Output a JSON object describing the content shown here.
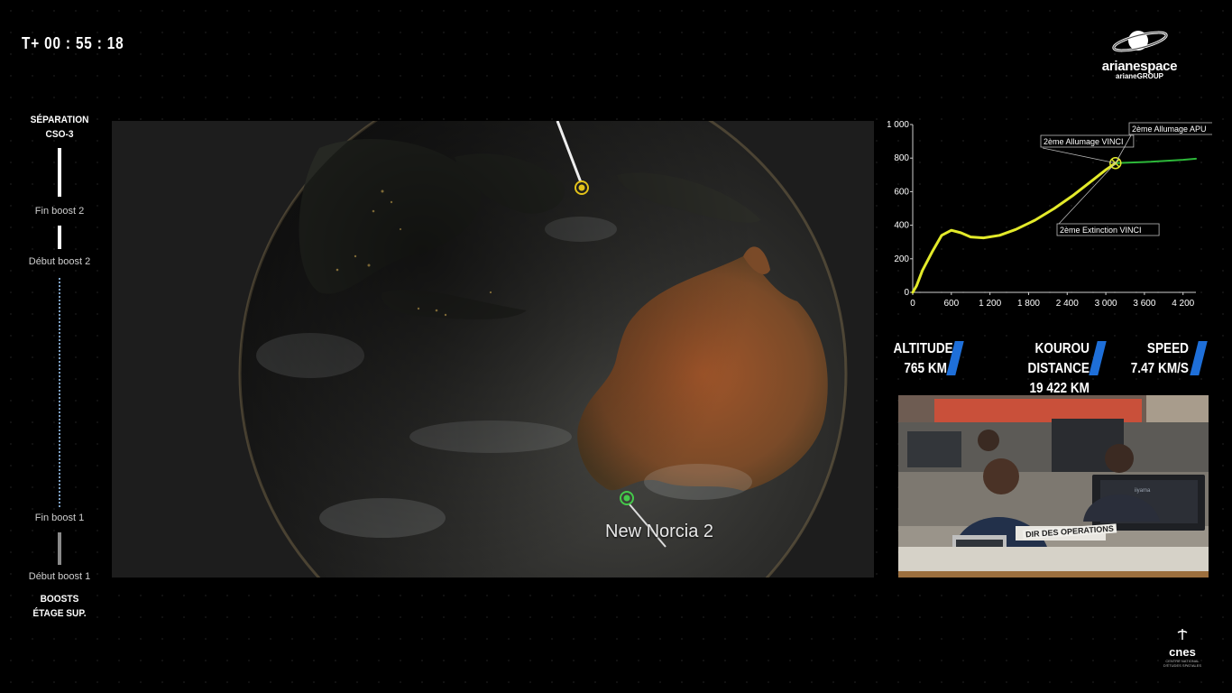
{
  "timer": "T+ 00 : 55 : 18",
  "logo": {
    "brand": "arianespace",
    "sub": "arianeGROUP"
  },
  "timeline": {
    "separation_line1": "SÉPARATION",
    "separation_line2": "CSO-3",
    "fin_boost_2": "Fin boost 2",
    "debut_boost_2": "Début boost 2",
    "fin_boost_1": "Fin boost 1",
    "debut_boost_1": "Début boost 1",
    "boosts_line1": "BOOSTS",
    "boosts_line2": "ÉTAGE SUP."
  },
  "map": {
    "station_label": "New Norcia 2"
  },
  "chart_data": {
    "type": "line",
    "x_ticks": [
      "0",
      "600",
      "1 200",
      "1 800",
      "2 400",
      "3 000",
      "3 600",
      "4 200"
    ],
    "y_ticks": [
      "0",
      "200",
      "400",
      "600",
      "800",
      "1 000"
    ],
    "xlim": [
      0,
      4400
    ],
    "ylim": [
      0,
      1000
    ],
    "series": [
      {
        "color": "#e3ea2a",
        "x": [
          0,
          60,
          150,
          300,
          450,
          600,
          750,
          900,
          1100,
          1350,
          1600,
          1900,
          2200,
          2500,
          2800,
          3000,
          3150
        ],
        "y": [
          0,
          40,
          130,
          240,
          340,
          370,
          355,
          330,
          325,
          340,
          375,
          430,
          500,
          580,
          670,
          730,
          770
        ]
      },
      {
        "color": "#2db83a",
        "x": [
          3150,
          3700,
          4200,
          4400
        ],
        "y": [
          770,
          778,
          790,
          796
        ]
      }
    ],
    "annotations": [
      {
        "text": "2ème Allumage VINCI"
      },
      {
        "text": "2ème Allumage APU"
      },
      {
        "text": "2ème Extinction VINCI"
      }
    ]
  },
  "readouts": {
    "altitude_label": "ALTITUDE",
    "altitude_value": "765 KM",
    "kourou_label": "KOUROU DISTANCE",
    "kourou_value": "19 422 KM",
    "speed_label": "SPEED",
    "speed_value": "7.47 KM/S"
  },
  "camera": {
    "desk_sign": "DIR DES OPERATIONS",
    "monitor_brand": "iiyama"
  },
  "cnes": {
    "brand": "cnes",
    "sub1": "CENTRE NATIONAL",
    "sub2": "D'ÉTUDES SPATIALES"
  },
  "colors": {
    "accent_blue": "#1e6fd9",
    "curve_yellow": "#e3ea2a",
    "curve_green": "#2db83a",
    "station_green": "#44c94a",
    "station_yellow": "#e2c21a"
  }
}
